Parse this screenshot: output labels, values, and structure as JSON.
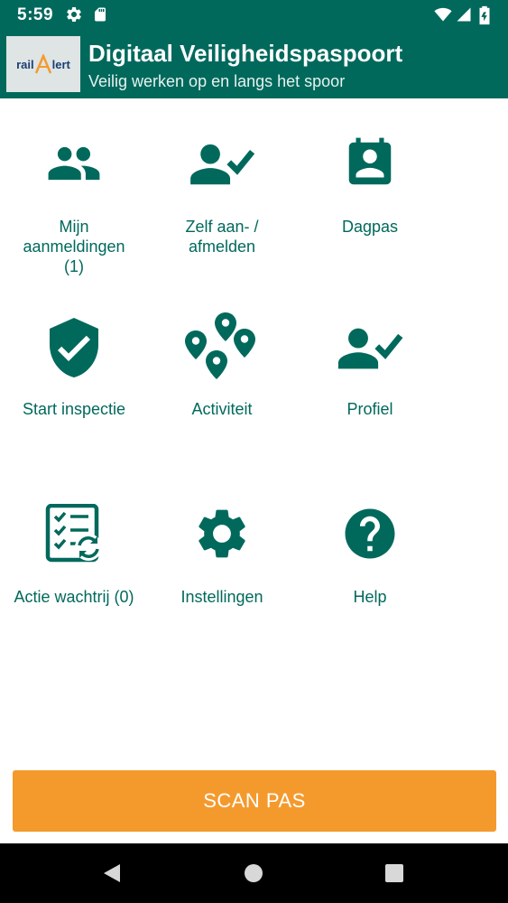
{
  "status_bar": {
    "time": "5:59"
  },
  "header": {
    "logo_rail": "rail",
    "logo_alert": "lert",
    "title": "Digitaal Veiligheidspaspoort",
    "subtitle": "Veilig werken op en langs het spoor"
  },
  "menu": [
    {
      "label": "Mijn\naanmeldingen\n(1)",
      "icon": "people-icon"
    },
    {
      "label": "Zelf aan- /\nafmelden",
      "icon": "person-check-icon"
    },
    {
      "label": "Dagpas",
      "icon": "badge-icon"
    },
    {
      "label": "Start inspectie",
      "icon": "shield-check-icon"
    },
    {
      "label": "Activiteit",
      "icon": "location-pins-icon"
    },
    {
      "label": "Profiel",
      "icon": "person-check-icon"
    },
    {
      "label": "Actie wachtrij (0)",
      "icon": "checklist-sync-icon"
    },
    {
      "label": "Instellingen",
      "icon": "gear-icon"
    },
    {
      "label": "Help",
      "icon": "help-icon"
    }
  ],
  "scan_button": {
    "label": "SCAN PAS"
  },
  "colors": {
    "primary": "#00695c",
    "accent": "#f49a2d"
  }
}
